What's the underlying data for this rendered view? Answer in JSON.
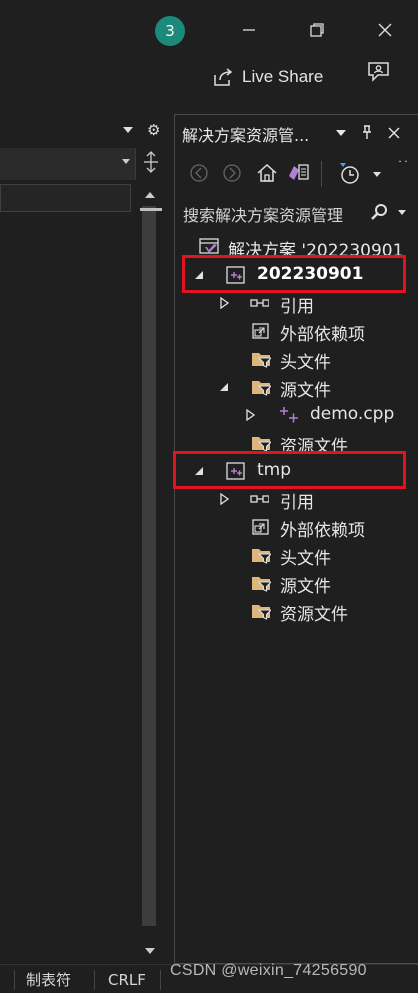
{
  "titlebar": {
    "badge": "3",
    "live_share_label": "Live Share"
  },
  "statusbar": {
    "tabs_label": "制表符",
    "line_ending": "CRLF",
    "watermark": "CSDN @weixin_74256590"
  },
  "solution_explorer": {
    "title": "解决方案资源管...",
    "search_placeholder": "搜索解决方案资源管理",
    "solution_label": "解决方案 '202230901",
    "projects": [
      {
        "name": "202230901",
        "items": {
          "references": "引用",
          "external_deps": "外部依赖项",
          "header_files": "头文件",
          "source_files": "源文件",
          "source_file_demo": "demo.cpp",
          "resource_files": "资源文件"
        }
      },
      {
        "name": "tmp",
        "items": {
          "references": "引用",
          "external_deps": "外部依赖项",
          "header_files": "头文件",
          "source_files": "源文件",
          "resource_files": "资源文件"
        }
      }
    ]
  },
  "colors": {
    "background": "#1f1f1f",
    "badge": "#1b8a7a",
    "highlight": "#e0141e",
    "vs_purple": "#b180d7",
    "folder": "#dcb67a"
  }
}
